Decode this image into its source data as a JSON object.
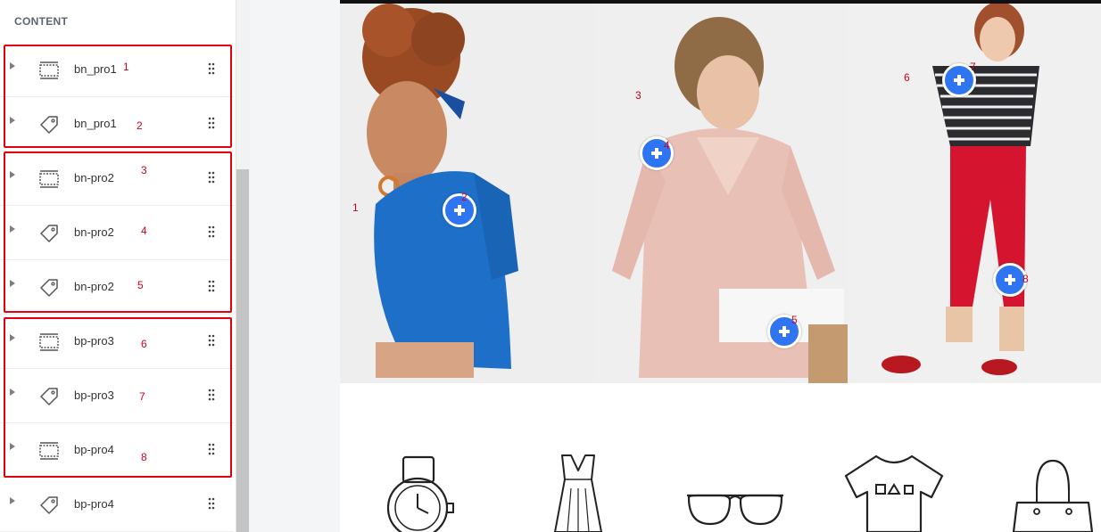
{
  "sidebar": {
    "header": "CONTENT",
    "items": [
      {
        "label": "bn_pro1",
        "icon": "section-icon",
        "num": "1"
      },
      {
        "label": "bn_pro1",
        "icon": "tag-icon",
        "num": "2"
      },
      {
        "label": "bn-pro2",
        "icon": "section-icon",
        "num": "3"
      },
      {
        "label": "bn-pro2",
        "icon": "tag-icon",
        "num": "4"
      },
      {
        "label": "bn-pro2",
        "icon": "tag-icon",
        "num": "5"
      },
      {
        "label": "bp-pro3",
        "icon": "section-icon",
        "num": "6"
      },
      {
        "label": "bp-pro3",
        "icon": "tag-icon",
        "num": "7"
      },
      {
        "label": "bp-pro4",
        "icon": "section-icon",
        "num": "8"
      },
      {
        "label": "bp-pro4",
        "icon": "tag-icon",
        "num": ""
      }
    ]
  },
  "canvas": {
    "photos": [
      {
        "name": "model-blue-top",
        "num": "1"
      },
      {
        "name": "model-pink-cardigan",
        "num": "3"
      },
      {
        "name": "model-striped-shirt",
        "num": "6"
      }
    ],
    "hotspots": [
      {
        "num": "2"
      },
      {
        "num": "4"
      },
      {
        "num": "5"
      },
      {
        "num": "7"
      },
      {
        "num": "8"
      }
    ],
    "categories": [
      "watch-icon",
      "dress-icon",
      "sunglasses-icon",
      "tshirt-icon",
      "handbag-icon"
    ]
  },
  "colors": {
    "accent": "#2f74f0",
    "annotation": "#e2000f"
  }
}
